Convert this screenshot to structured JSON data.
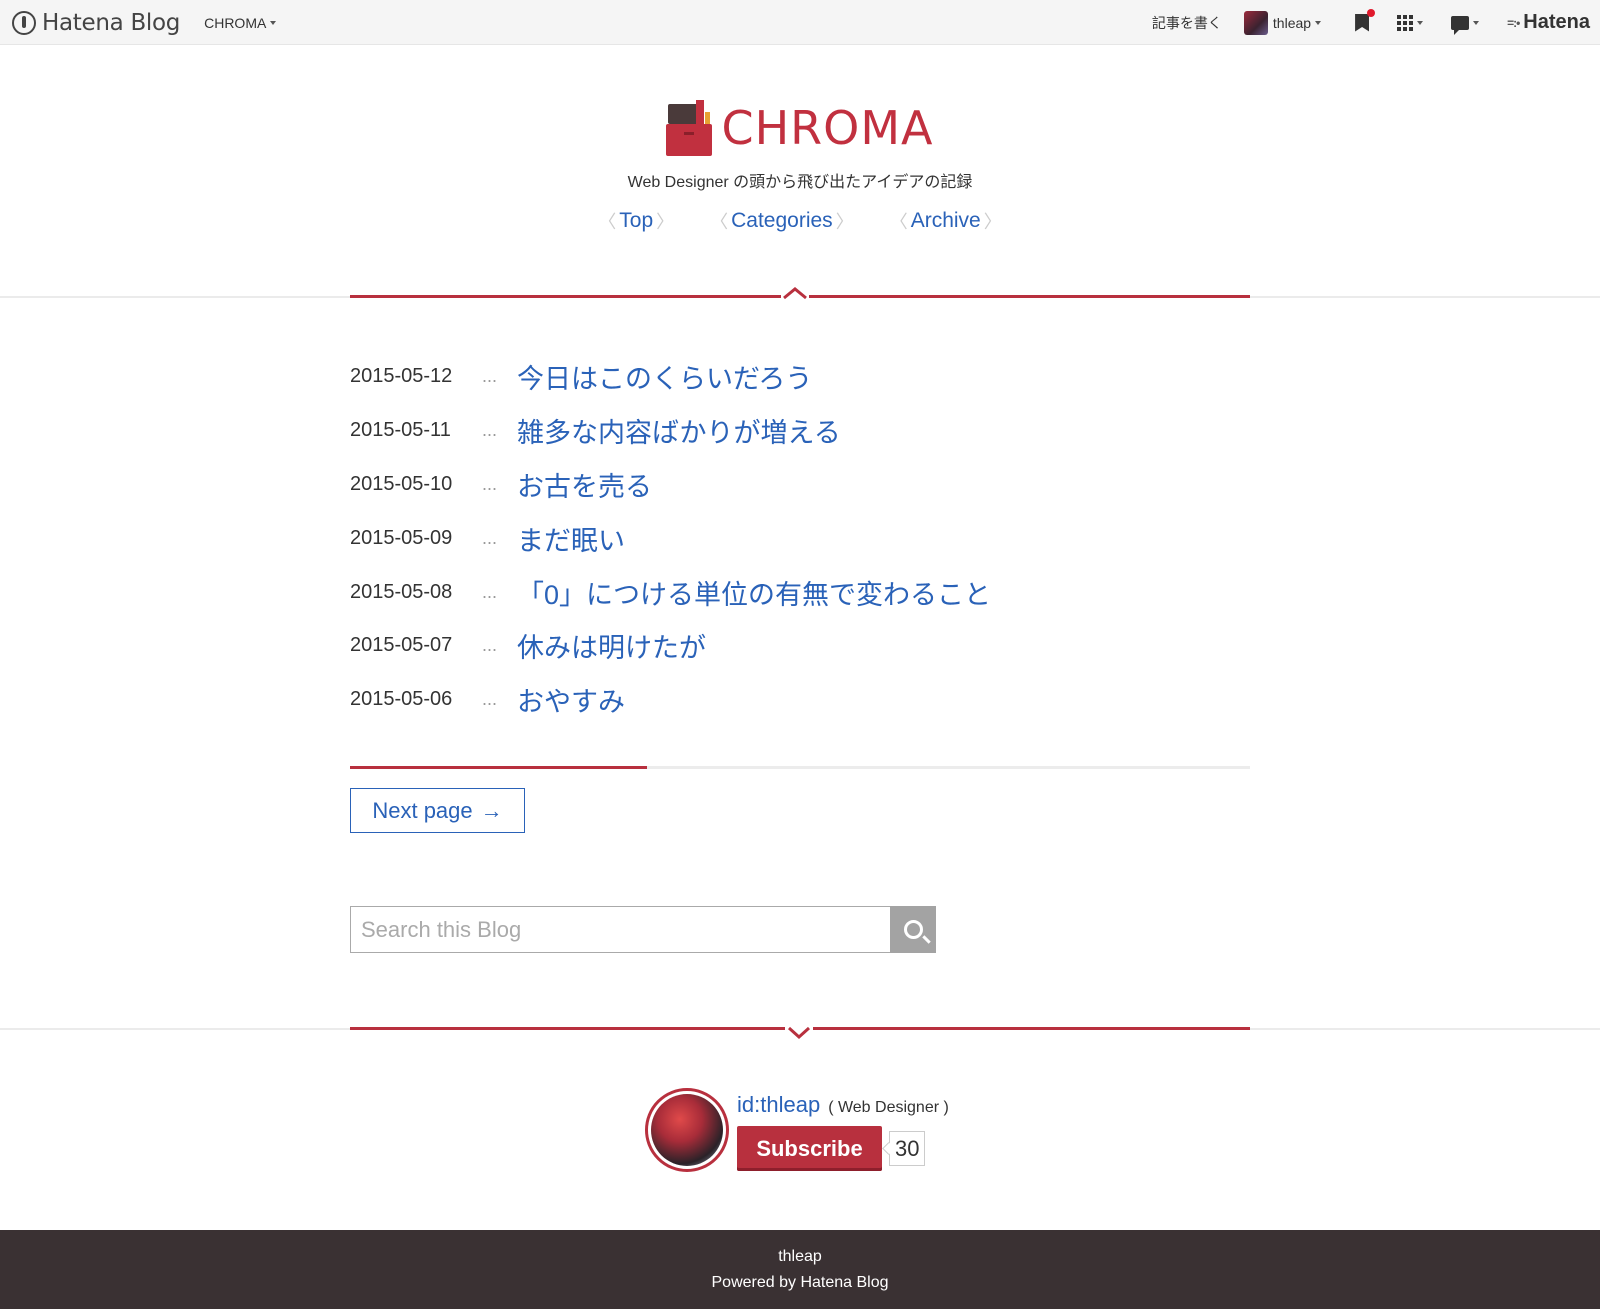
{
  "topbar": {
    "brand": "Hatena Blog",
    "blog_menu": "CHROMA",
    "write_link": "記事を書く",
    "username": "thleap",
    "hatena": "Hatena"
  },
  "header": {
    "title": "CHROMA",
    "description": "Web Designer の頭から飛び出たアイデアの記録"
  },
  "nav": [
    {
      "label": "Top"
    },
    {
      "label": "Categories"
    },
    {
      "label": "Archive"
    }
  ],
  "entries": [
    {
      "date": "2015-05-12",
      "title": "今日はこのくらいだろう"
    },
    {
      "date": "2015-05-11",
      "title": "雑多な内容ばかりが増える"
    },
    {
      "date": "2015-05-10",
      "title": "お古を売る"
    },
    {
      "date": "2015-05-09",
      "title": "まだ眠い"
    },
    {
      "date": "2015-05-08",
      "title": "「0」につける単位の有無で変わること"
    },
    {
      "date": "2015-05-07",
      "title": "休みは明けたが"
    },
    {
      "date": "2015-05-06",
      "title": "おやすみ"
    }
  ],
  "entry_separator": "...",
  "pager": {
    "progress": 0.33,
    "next_label": "Next page",
    "next_arrow": "→"
  },
  "search": {
    "placeholder": "Search this Blog",
    "value": ""
  },
  "author": {
    "id": "id:thleap",
    "role": "( Web Designer )",
    "subscribe_label": "Subscribe",
    "subscriber_count": "30"
  },
  "footer": {
    "name": "thleap",
    "powered": "Powered by Hatena Blog"
  },
  "colors": {
    "accent": "#b8303e",
    "link": "#2a62b8",
    "footer_bg": "#3a3133"
  },
  "icons": [
    "hatena-blog-logo-icon",
    "bookmark-icon",
    "apps-grid-icon",
    "comment-icon",
    "hatena-logo-icon",
    "search-icon",
    "arrow-right-icon"
  ]
}
